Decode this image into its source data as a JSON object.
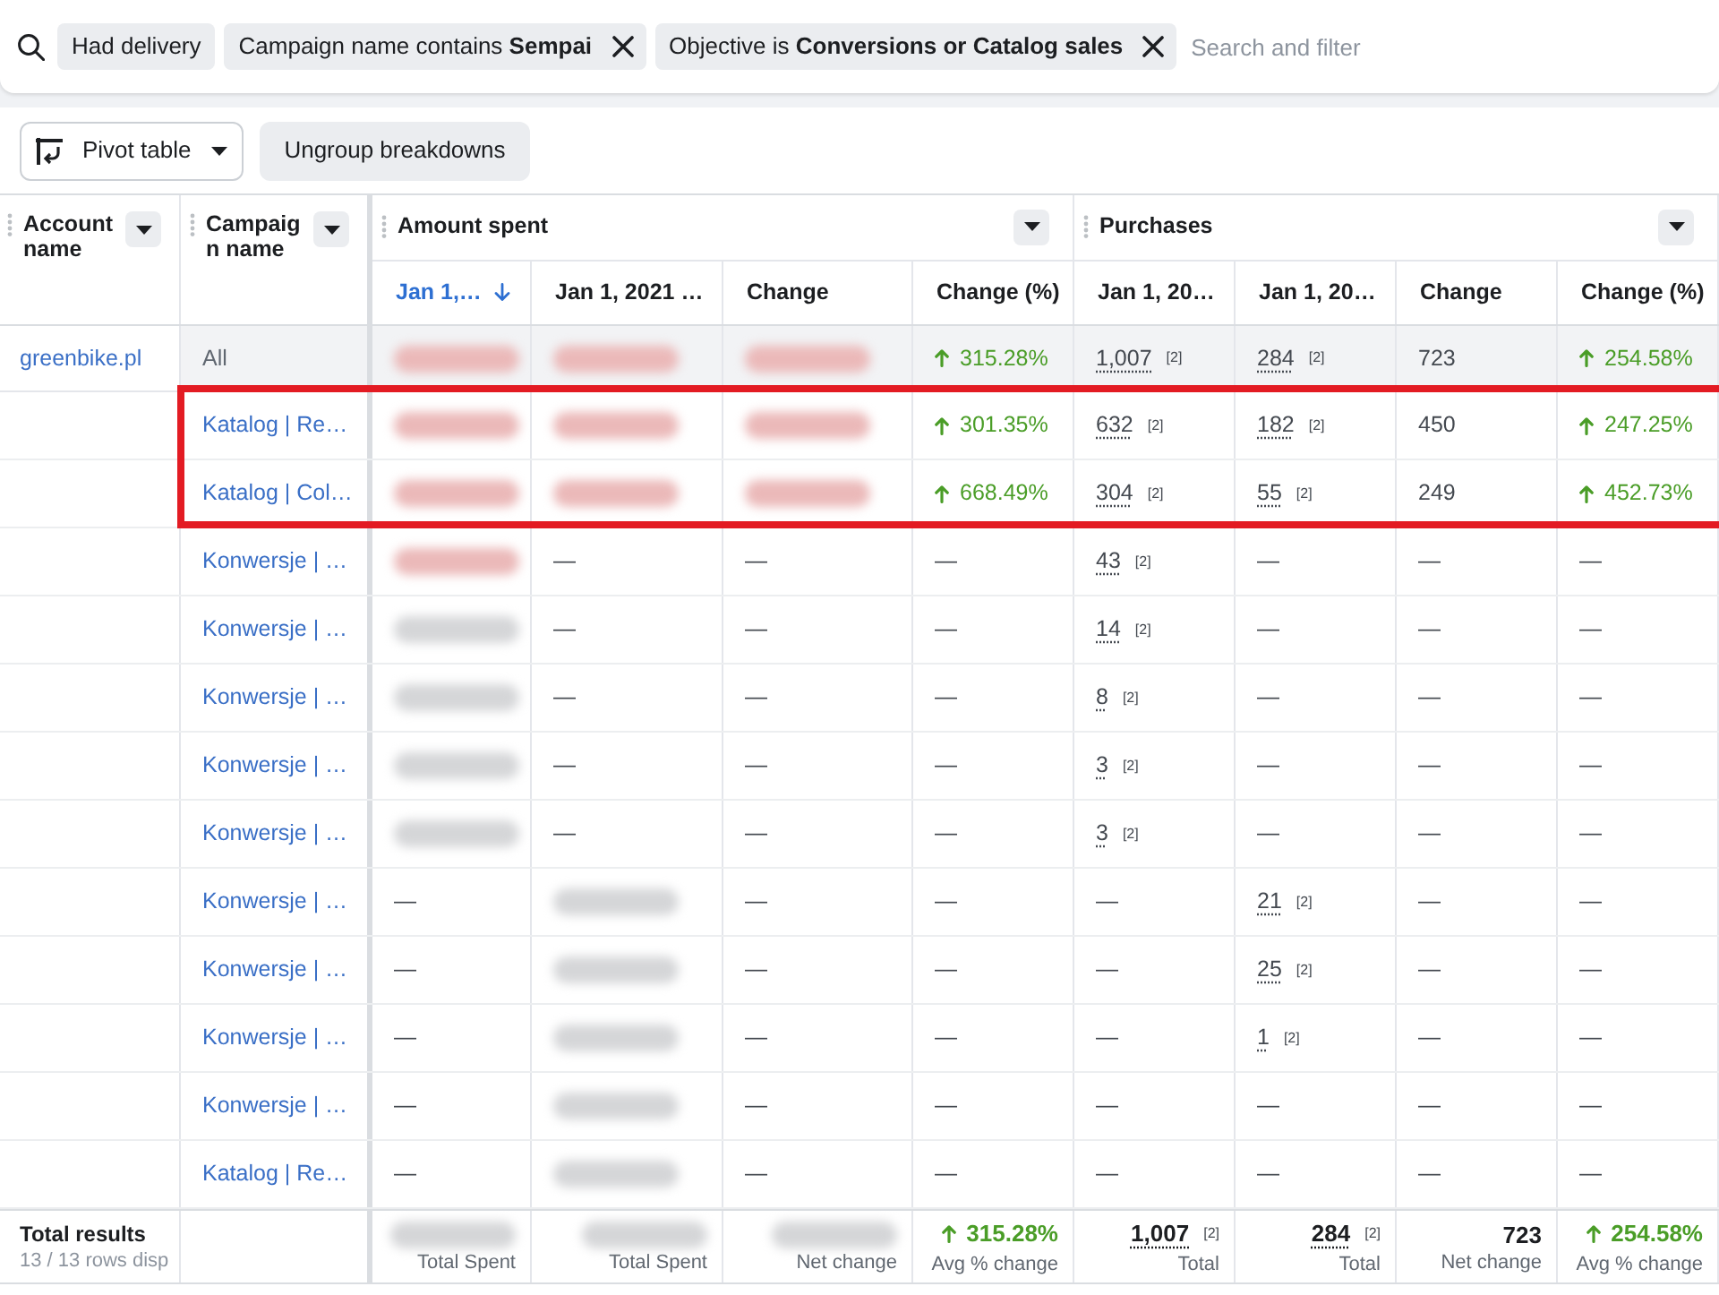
{
  "filter_bar": {
    "chips": [
      {
        "text": "Had delivery",
        "removable": false
      },
      {
        "text": "Campaign name contains **Sempai**",
        "removable": true
      },
      {
        "text": "Objective is **Conversions or Catalog sales**",
        "removable": true
      }
    ],
    "placeholder": "Search and filter"
  },
  "toolbar": {
    "pivot_button": "Pivot table",
    "ungroup_button": "Ungroup breakdowns"
  },
  "table": {
    "fixed_columns": [
      "Account name",
      "Campaign name"
    ],
    "groups": [
      {
        "title": "Amount spent",
        "columns": [
          {
            "label": "Jan 1,…",
            "sorted": true
          },
          {
            "label": "Jan 1, 2021 …",
            "sorted": false
          },
          {
            "label": "Change",
            "sorted": false
          },
          {
            "label": "Change (%)",
            "sorted": false
          }
        ]
      },
      {
        "title": "Purchases",
        "columns": [
          {
            "label": "Jan 1, 20…",
            "sorted": false
          },
          {
            "label": "Jan 1, 20…",
            "sorted": false
          },
          {
            "label": "Change",
            "sorted": false
          },
          {
            "label": "Change (%)",
            "sorted": false
          }
        ]
      }
    ],
    "summary_row": {
      "account": "greenbike.pl",
      "campaign": "All",
      "cells": [
        {
          "kind": "blur",
          "tinted": true
        },
        {
          "kind": "blur",
          "tinted": true
        },
        {
          "kind": "blur",
          "tinted": true
        },
        {
          "kind": "percent",
          "rising": true,
          "text": "315.28%"
        },
        {
          "kind": "count",
          "text": "1,007",
          "note": "[2]"
        },
        {
          "kind": "count",
          "text": "284",
          "note": "[2]"
        },
        {
          "kind": "text",
          "text": "723"
        },
        {
          "kind": "percent",
          "rising": true,
          "text": "254.58%"
        }
      ]
    },
    "rows": [
      {
        "campaign": "Katalog | Re…",
        "highlighted": true,
        "cells": [
          {
            "kind": "blur",
            "tinted": true
          },
          {
            "kind": "blur",
            "tinted": true
          },
          {
            "kind": "blur",
            "tinted": true
          },
          {
            "kind": "percent",
            "rising": true,
            "text": "301.35%"
          },
          {
            "kind": "count",
            "text": "632",
            "note": "[2]"
          },
          {
            "kind": "count",
            "text": "182",
            "note": "[2]"
          },
          {
            "kind": "text",
            "text": "450"
          },
          {
            "kind": "percent",
            "rising": true,
            "text": "247.25%"
          }
        ]
      },
      {
        "campaign": "Katalog | Col…",
        "highlighted": true,
        "cells": [
          {
            "kind": "blur",
            "tinted": true
          },
          {
            "kind": "blur",
            "tinted": true
          },
          {
            "kind": "blur",
            "tinted": true
          },
          {
            "kind": "percent",
            "rising": true,
            "text": "668.49%"
          },
          {
            "kind": "count",
            "text": "304",
            "note": "[2]"
          },
          {
            "kind": "count",
            "text": "55",
            "note": "[2]"
          },
          {
            "kind": "text",
            "text": "249"
          },
          {
            "kind": "percent",
            "rising": true,
            "text": "452.73%"
          }
        ]
      },
      {
        "campaign": "Konwersje | …",
        "highlighted": false,
        "cells": [
          {
            "kind": "blur",
            "tinted": true
          },
          {
            "kind": "text",
            "text": "—"
          },
          {
            "kind": "text",
            "text": "—"
          },
          {
            "kind": "text",
            "text": "—"
          },
          {
            "kind": "count",
            "text": "43",
            "note": "[2]"
          },
          {
            "kind": "text",
            "text": "—"
          },
          {
            "kind": "text",
            "text": "—"
          },
          {
            "kind": "text",
            "text": "—"
          }
        ]
      },
      {
        "campaign": "Konwersje | …",
        "highlighted": false,
        "cells": [
          {
            "kind": "blur",
            "tinted": false
          },
          {
            "kind": "text",
            "text": "—"
          },
          {
            "kind": "text",
            "text": "—"
          },
          {
            "kind": "text",
            "text": "—"
          },
          {
            "kind": "count",
            "text": "14",
            "note": "[2]"
          },
          {
            "kind": "text",
            "text": "—"
          },
          {
            "kind": "text",
            "text": "—"
          },
          {
            "kind": "text",
            "text": "—"
          }
        ]
      },
      {
        "campaign": "Konwersje | …",
        "highlighted": false,
        "cells": [
          {
            "kind": "blur",
            "tinted": false
          },
          {
            "kind": "text",
            "text": "—"
          },
          {
            "kind": "text",
            "text": "—"
          },
          {
            "kind": "text",
            "text": "—"
          },
          {
            "kind": "count",
            "text": "8",
            "note": "[2]"
          },
          {
            "kind": "text",
            "text": "—"
          },
          {
            "kind": "text",
            "text": "—"
          },
          {
            "kind": "text",
            "text": "—"
          }
        ]
      },
      {
        "campaign": "Konwersje | …",
        "highlighted": false,
        "cells": [
          {
            "kind": "blur",
            "tinted": false
          },
          {
            "kind": "text",
            "text": "—"
          },
          {
            "kind": "text",
            "text": "—"
          },
          {
            "kind": "text",
            "text": "—"
          },
          {
            "kind": "count",
            "text": "3",
            "note": "[2]"
          },
          {
            "kind": "text",
            "text": "—"
          },
          {
            "kind": "text",
            "text": "—"
          },
          {
            "kind": "text",
            "text": "—"
          }
        ]
      },
      {
        "campaign": "Konwersje | …",
        "highlighted": false,
        "cells": [
          {
            "kind": "blur",
            "tinted": false
          },
          {
            "kind": "text",
            "text": "—"
          },
          {
            "kind": "text",
            "text": "—"
          },
          {
            "kind": "text",
            "text": "—"
          },
          {
            "kind": "count",
            "text": "3",
            "note": "[2]"
          },
          {
            "kind": "text",
            "text": "—"
          },
          {
            "kind": "text",
            "text": "—"
          },
          {
            "kind": "text",
            "text": "—"
          }
        ]
      },
      {
        "campaign": "Konwersje | …",
        "highlighted": false,
        "cells": [
          {
            "kind": "text",
            "text": "—"
          },
          {
            "kind": "blur",
            "tinted": false
          },
          {
            "kind": "text",
            "text": "—"
          },
          {
            "kind": "text",
            "text": "—"
          },
          {
            "kind": "text",
            "text": "—"
          },
          {
            "kind": "count",
            "text": "21",
            "note": "[2]"
          },
          {
            "kind": "text",
            "text": "—"
          },
          {
            "kind": "text",
            "text": "—"
          }
        ]
      },
      {
        "campaign": "Konwersje | …",
        "highlighted": false,
        "cells": [
          {
            "kind": "text",
            "text": "—"
          },
          {
            "kind": "blur",
            "tinted": false
          },
          {
            "kind": "text",
            "text": "—"
          },
          {
            "kind": "text",
            "text": "—"
          },
          {
            "kind": "text",
            "text": "—"
          },
          {
            "kind": "count",
            "text": "25",
            "note": "[2]"
          },
          {
            "kind": "text",
            "text": "—"
          },
          {
            "kind": "text",
            "text": "—"
          }
        ]
      },
      {
        "campaign": "Konwersje | …",
        "highlighted": false,
        "cells": [
          {
            "kind": "text",
            "text": "—"
          },
          {
            "kind": "blur",
            "tinted": false
          },
          {
            "kind": "text",
            "text": "—"
          },
          {
            "kind": "text",
            "text": "—"
          },
          {
            "kind": "text",
            "text": "—"
          },
          {
            "kind": "count",
            "text": "1",
            "note": "[2]"
          },
          {
            "kind": "text",
            "text": "—"
          },
          {
            "kind": "text",
            "text": "—"
          }
        ]
      },
      {
        "campaign": "Konwersje | …",
        "highlighted": false,
        "cells": [
          {
            "kind": "text",
            "text": "—"
          },
          {
            "kind": "blur",
            "tinted": false
          },
          {
            "kind": "text",
            "text": "—"
          },
          {
            "kind": "text",
            "text": "—"
          },
          {
            "kind": "text",
            "text": "—"
          },
          {
            "kind": "text",
            "text": "—"
          },
          {
            "kind": "text",
            "text": "—"
          },
          {
            "kind": "text",
            "text": "—"
          }
        ]
      },
      {
        "campaign": "Katalog | Re…",
        "highlighted": false,
        "cells": [
          {
            "kind": "text",
            "text": "—"
          },
          {
            "kind": "blur",
            "tinted": false
          },
          {
            "kind": "text",
            "text": "—"
          },
          {
            "kind": "text",
            "text": "—"
          },
          {
            "kind": "text",
            "text": "—"
          },
          {
            "kind": "text",
            "text": "—"
          },
          {
            "kind": "text",
            "text": "—"
          },
          {
            "kind": "text",
            "text": "—"
          }
        ]
      }
    ],
    "footer": {
      "title": "Total results",
      "subtitle": "13 / 13 rows disp",
      "cells": [
        {
          "kind": "blur",
          "tinted": false,
          "label": "Total Spent"
        },
        {
          "kind": "blur",
          "tinted": false,
          "label": "Total Spent"
        },
        {
          "kind": "blur",
          "tinted": false,
          "label": "Net change"
        },
        {
          "kind": "percent",
          "rising": true,
          "text": "315.28%",
          "label": "Avg % change"
        },
        {
          "kind": "count",
          "text": "1,007",
          "note": "[2]",
          "label": "Total"
        },
        {
          "kind": "count",
          "text": "284",
          "note": "[2]",
          "label": "Total"
        },
        {
          "kind": "text",
          "text": "723",
          "label": "Net change"
        },
        {
          "kind": "percent",
          "rising": true,
          "text": "254.58%",
          "label": "Avg % change"
        }
      ]
    }
  }
}
